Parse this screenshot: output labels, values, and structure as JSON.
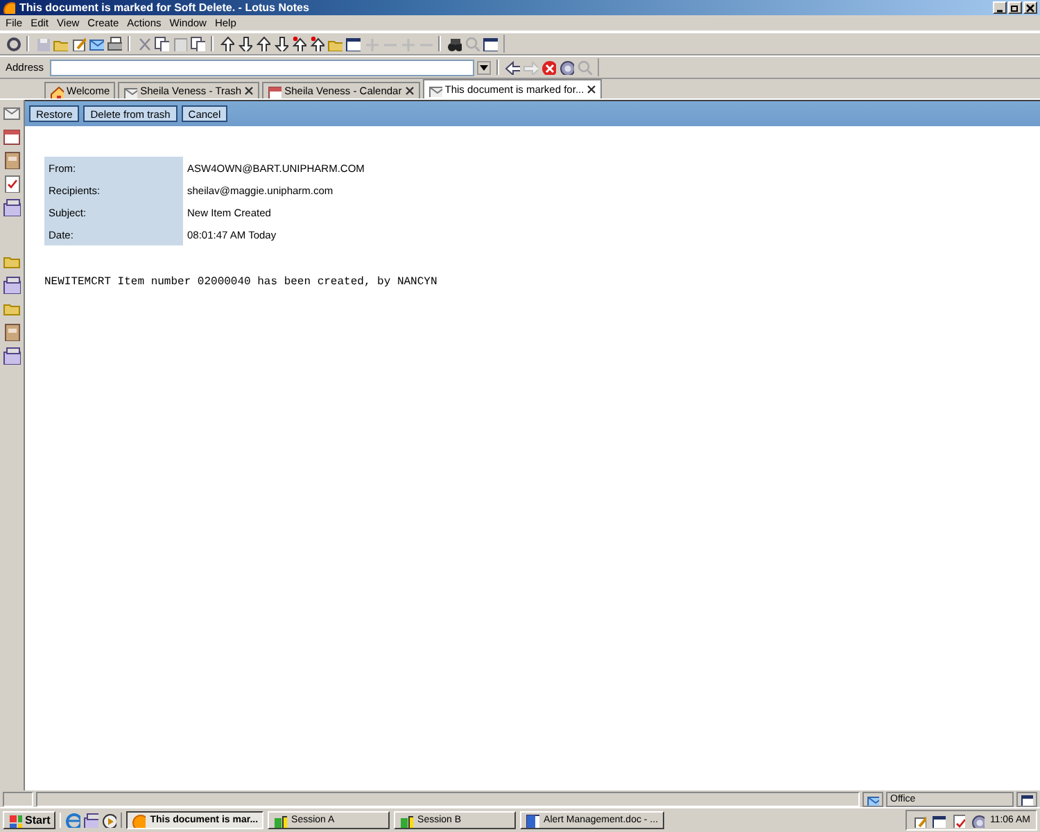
{
  "window": {
    "title": "This document is marked for Soft Delete. - Lotus Notes"
  },
  "menu": [
    "File",
    "Edit",
    "View",
    "Create",
    "Actions",
    "Window",
    "Help"
  ],
  "address": {
    "label": "Address"
  },
  "tabs": [
    {
      "label": "Welcome",
      "selected": false,
      "kind": "home",
      "closable": false
    },
    {
      "label": "Sheila Veness - Trash",
      "selected": false,
      "kind": "mail",
      "closable": true
    },
    {
      "label": "Sheila Veness - Calendar",
      "selected": false,
      "kind": "calendar",
      "closable": true
    },
    {
      "label": "This document is marked for...",
      "selected": true,
      "kind": "mail",
      "closable": true
    }
  ],
  "actions": [
    "Restore",
    "Delete from trash",
    "Cancel"
  ],
  "memo": {
    "fields": [
      {
        "label": "From:",
        "value": "ASW4OWN@BART.UNIPHARM.COM"
      },
      {
        "label": "Recipients:",
        "value": "sheilav@maggie.unipharm.com"
      },
      {
        "label": "Subject:",
        "value": "New Item Created"
      },
      {
        "label": "Date:",
        "value": "08:01:47 AM Today"
      }
    ],
    "body": "NEWITEMCRT Item number 02000040 has been created, by NANCYN"
  },
  "status_bar": {
    "location": "Office"
  },
  "taskbar": {
    "start": "Start",
    "buttons": [
      {
        "label": "This document is mar...",
        "selected": true,
        "kind": "notes"
      },
      {
        "label": "Session A",
        "selected": false,
        "kind": "session"
      },
      {
        "label": "Session B",
        "selected": false,
        "kind": "session"
      },
      {
        "label": "Alert Management.doc - ...",
        "selected": false,
        "kind": "word"
      }
    ],
    "clock": "11:06 AM"
  }
}
